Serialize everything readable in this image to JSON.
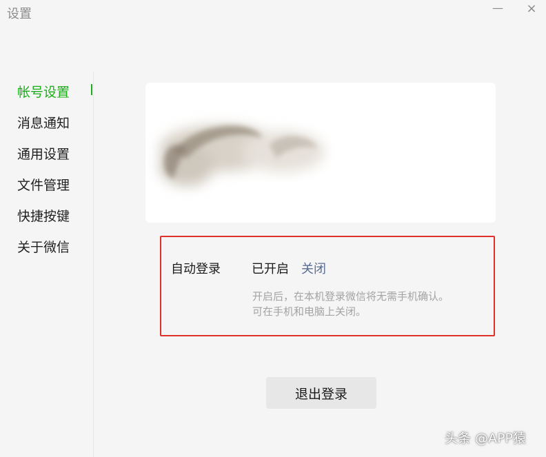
{
  "window": {
    "title": "设置",
    "minimize_glyph": "—",
    "close_glyph": "×"
  },
  "sidebar": {
    "items": [
      {
        "label": "帐号设置",
        "active": true
      },
      {
        "label": "消息通知"
      },
      {
        "label": "通用设置"
      },
      {
        "label": "文件管理"
      },
      {
        "label": "快捷按键"
      },
      {
        "label": "关于微信"
      }
    ]
  },
  "account": {
    "auto_login_label": "自动登录",
    "auto_login_status": "已开启",
    "auto_login_toggle": "关闭",
    "description_line1": "开启后，在本机登录微信将无需手机确认。",
    "description_line2": "可在手机和电脑上关闭。"
  },
  "logout_button": "退出登录",
  "watermark": "头条 @APP猿",
  "colors": {
    "accent": "#1aad19",
    "link": "#576b95",
    "highlight_border": "#e0302a"
  }
}
